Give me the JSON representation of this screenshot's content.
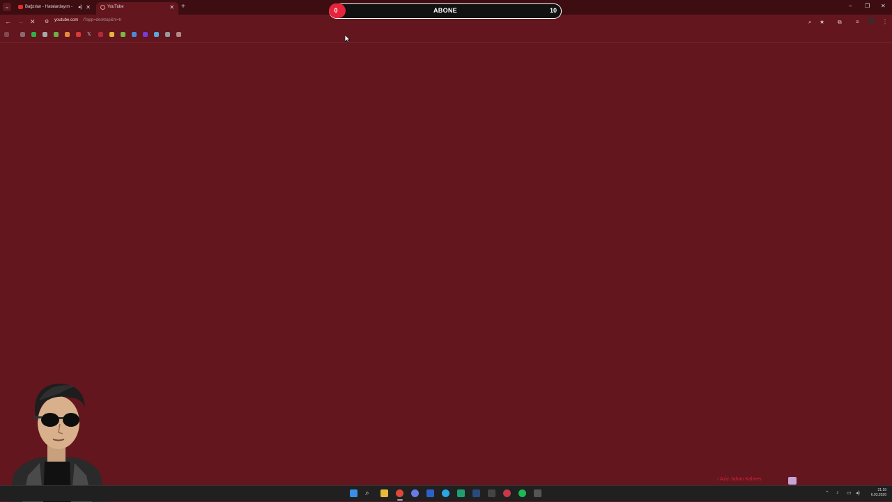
{
  "browser": {
    "tabs": [
      {
        "title": "Bağzılan - Hatalardayım - Y",
        "state": "inactive",
        "audio": true
      },
      {
        "title": "YouTube",
        "state": "active",
        "audio": false
      }
    ],
    "address": {
      "host": "youtube.com",
      "path": "/?app=desktop&hl=tr"
    }
  },
  "overlay": {
    "subscriber_goal": {
      "current": "0",
      "label": "ABONE",
      "target": "10",
      "progress": 0
    },
    "now_playing": "♪ Aziz Jahan Kalmes",
    "accent": "#e5243b"
  },
  "taskbar": {
    "time": "21:18",
    "date": "6.03.2026"
  },
  "colors": {
    "page_background": "#63161e",
    "tabstrip": "#3d0d12",
    "taskbar": "#202020"
  }
}
